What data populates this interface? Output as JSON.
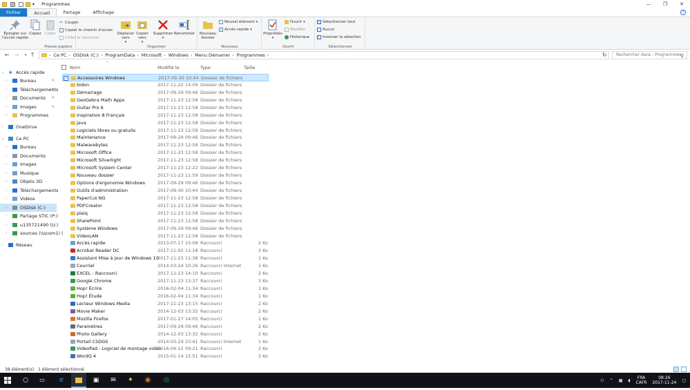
{
  "window": {
    "title": "Programmes",
    "controls": [
      "—",
      "❐",
      "✕"
    ]
  },
  "ribbon_tabs": [
    "Fichier",
    "Accueil",
    "Partage",
    "Affichage"
  ],
  "ribbon": {
    "presse_papiers": {
      "label": "Presse-papiers",
      "pin": "Épingler sur l'accès rapide",
      "copy": "Copier",
      "paste": "Coller",
      "cut": "Couper",
      "copy_path": "Copier le chemin d'accès",
      "paste_shortcut": "Coller le raccourci"
    },
    "organiser": {
      "label": "Organiser",
      "move": "Déplacer vers",
      "copy_to": "Copier vers",
      "delete": "Supprimer",
      "rename": "Renommer"
    },
    "nouveau": {
      "label": "Nouveau",
      "new_folder": "Nouveau dossier",
      "new_item": "Nouvel élément",
      "quick_access": "Accès rapide"
    },
    "ouvrir": {
      "label": "Ouvrir",
      "properties": "Propriétés",
      "open": "Ouvrir",
      "modify": "Modifier",
      "history": "Historique"
    },
    "selectionner": {
      "label": "Sélectionner",
      "select_all": "Sélectionner tout",
      "none": "Aucun",
      "invert": "Inverser la sélection"
    }
  },
  "address": {
    "path": [
      "Ce PC",
      "OSDisk (C:)",
      "ProgramData",
      "Microsoft",
      "Windows",
      "Menu Démarrer",
      "Programmes"
    ],
    "search_placeholder": "Rechercher dans : Programmes"
  },
  "nav_pane": [
    {
      "label": "Accès rapide",
      "level": 0,
      "icon": "star-icon",
      "expanded": true
    },
    {
      "label": "Bureau",
      "level": 1,
      "icon": "desktop-icon",
      "pinned": true
    },
    {
      "label": "Téléchargements",
      "level": 1,
      "icon": "download-icon",
      "pinned": true
    },
    {
      "label": "Documents",
      "level": 1,
      "icon": "documents-icon",
      "pinned": true
    },
    {
      "label": "Images",
      "level": 1,
      "icon": "images-icon",
      "pinned": true
    },
    {
      "label": "Programmes",
      "level": 1,
      "icon": "folder-icon"
    },
    {
      "label": "OneDrive",
      "level": 0,
      "icon": "cloud-icon"
    },
    {
      "label": "Ce PC",
      "level": 0,
      "icon": "computer-icon",
      "expanded": true
    },
    {
      "label": "Bureau",
      "level": 1,
      "icon": "desktop-icon"
    },
    {
      "label": "Documents",
      "level": 1,
      "icon": "documents-icon"
    },
    {
      "label": "Images",
      "level": 1,
      "icon": "images-icon"
    },
    {
      "label": "Musique",
      "level": 1,
      "icon": "music-icon"
    },
    {
      "label": "Objets 3D",
      "level": 1,
      "icon": "objects3d-icon"
    },
    {
      "label": "Téléchargements",
      "level": 1,
      "icon": "download-icon"
    },
    {
      "label": "Vidéos",
      "level": 1,
      "icon": "video-icon"
    },
    {
      "label": "OSDisk (C:)",
      "level": 1,
      "icon": "drive-icon",
      "selected": true
    },
    {
      "label": "Partage STIC (P:)",
      "level": 1,
      "icon": "network-drive-icon"
    },
    {
      "label": "u135721490 (U:)",
      "level": 1,
      "icon": "network-drive-icon"
    },
    {
      "label": "sources (\\\\scom1) (",
      "level": 1,
      "icon": "network-drive-icon"
    },
    {
      "label": "Réseau",
      "level": 0,
      "icon": "network-icon"
    }
  ],
  "columns": [
    "Nom",
    "Modifié le",
    "Type",
    "Taille"
  ],
  "files": [
    {
      "name": "Accessoires Windows",
      "date": "2017-09-30 10:44",
      "type": "Dossier de fichiers",
      "size": "",
      "kind": "folder",
      "selected": true
    },
    {
      "name": "bidon",
      "date": "2017-11-22 14:09",
      "type": "Dossier de fichiers",
      "size": "",
      "kind": "folder"
    },
    {
      "name": "Démarrage",
      "date": "2017-09-29 09:46",
      "type": "Dossier de fichiers",
      "size": "",
      "kind": "folder"
    },
    {
      "name": "GeoGebra Math Apps",
      "date": "2017-11-23 12:58",
      "type": "Dossier de fichiers",
      "size": "",
      "kind": "folder"
    },
    {
      "name": "Guitar Pro 6",
      "date": "2017-11-23 12:58",
      "type": "Dossier de fichiers",
      "size": "",
      "kind": "folder"
    },
    {
      "name": "Inspiration 8 Français",
      "date": "2017-11-23 12:58",
      "type": "Dossier de fichiers",
      "size": "",
      "kind": "folder"
    },
    {
      "name": "Java",
      "date": "2017-11-23 12:58",
      "type": "Dossier de fichiers",
      "size": "",
      "kind": "folder"
    },
    {
      "name": "Logiciels libres ou gratuits",
      "date": "2017-11-23 12:58",
      "type": "Dossier de fichiers",
      "size": "",
      "kind": "folder"
    },
    {
      "name": "Maintenance",
      "date": "2017-09-29 09:46",
      "type": "Dossier de fichiers",
      "size": "",
      "kind": "folder"
    },
    {
      "name": "Malwarebytes",
      "date": "2017-11-23 12:58",
      "type": "Dossier de fichiers",
      "size": "",
      "kind": "folder"
    },
    {
      "name": "Microsoft Office",
      "date": "2017-11-23 12:58",
      "type": "Dossier de fichiers",
      "size": "",
      "kind": "folder"
    },
    {
      "name": "Microsoft Silverlight",
      "date": "2017-11-23 12:58",
      "type": "Dossier de fichiers",
      "size": "",
      "kind": "folder"
    },
    {
      "name": "Microsoft System Center",
      "date": "2017-11-23 12:22",
      "type": "Dossier de fichiers",
      "size": "",
      "kind": "folder"
    },
    {
      "name": "Nouveau dossier",
      "date": "2017-11-23 11:59",
      "type": "Dossier de fichiers",
      "size": "",
      "kind": "folder"
    },
    {
      "name": "Options d'ergonomie Windows",
      "date": "2017-09-29 09:46",
      "type": "Dossier de fichiers",
      "size": "",
      "kind": "folder"
    },
    {
      "name": "Outils d'administration",
      "date": "2017-09-30 10:44",
      "type": "Dossier de fichiers",
      "size": "",
      "kind": "folder"
    },
    {
      "name": "PaperCut NG",
      "date": "2017-11-23 12:58",
      "type": "Dossier de fichiers",
      "size": "",
      "kind": "folder"
    },
    {
      "name": "PDFCreator",
      "date": "2017-11-23 12:58",
      "type": "Dossier de fichiers",
      "size": "",
      "kind": "folder"
    },
    {
      "name": "plaiq",
      "date": "2017-11-23 12:58",
      "type": "Dossier de fichiers",
      "size": "",
      "kind": "folder"
    },
    {
      "name": "SharePoint",
      "date": "2017-11-23 12:58",
      "type": "Dossier de fichiers",
      "size": "",
      "kind": "folder"
    },
    {
      "name": "Système Windows",
      "date": "2017-09-29 09:46",
      "type": "Dossier de fichiers",
      "size": "",
      "kind": "folder"
    },
    {
      "name": "VideoLAN",
      "date": "2017-11-23 12:58",
      "type": "Dossier de fichiers",
      "size": "",
      "kind": "folder"
    },
    {
      "name": "Accès rapide",
      "date": "2013-07-17 15:08",
      "type": "Raccourci",
      "size": "2 Ko",
      "kind": "shortcut",
      "color": "#6aa0d8"
    },
    {
      "name": "Acrobat Reader DC",
      "date": "2017-11-02 11:18",
      "type": "Raccourci",
      "size": "3 Ko",
      "kind": "shortcut",
      "color": "#c8282b"
    },
    {
      "name": "Assistant Mise à jour de Windows 10",
      "date": "2017-11-23 11:38",
      "type": "Raccourci",
      "size": "1 Ko",
      "kind": "shortcut",
      "color": "#2f7ad0"
    },
    {
      "name": "Courriel",
      "date": "2014-03-24 10:26",
      "type": "Raccourci Internet",
      "size": "1 Ko",
      "kind": "shortcut",
      "color": "#9aa4b0"
    },
    {
      "name": "EXCEL - Raccourci",
      "date": "2017-11-23 14:10",
      "type": "Raccourci",
      "size": "2 Ko",
      "kind": "shortcut",
      "color": "#1f7a44"
    },
    {
      "name": "Google Chrome",
      "date": "2017-11-23 13:37",
      "type": "Raccourci",
      "size": "3 Ko",
      "kind": "shortcut",
      "color": "#3c9a4a"
    },
    {
      "name": "Hop! Écrire",
      "date": "2016-02-04 11:34",
      "type": "Raccourci",
      "size": "1 Ko",
      "kind": "shortcut",
      "color": "#5fae3c"
    },
    {
      "name": "Hop! Étude",
      "date": "2016-02-04 11:34",
      "type": "Raccourci",
      "size": "1 Ko",
      "kind": "shortcut",
      "color": "#5fae3c"
    },
    {
      "name": "Lecteur Windows Media",
      "date": "2017-11-23 13:15",
      "type": "Raccourci",
      "size": "2 Ko",
      "kind": "shortcut",
      "color": "#2b69c4"
    },
    {
      "name": "Movie Maker",
      "date": "2014-12-03 13:32",
      "type": "Raccourci",
      "size": "2 Ko",
      "kind": "shortcut",
      "color": "#7a5aa8"
    },
    {
      "name": "Mozilla Firefox",
      "date": "2017-01-27 14:05",
      "type": "Raccourci",
      "size": "1 Ko",
      "kind": "shortcut",
      "color": "#e0751f"
    },
    {
      "name": "Paramètres",
      "date": "2017-09-29 09:46",
      "type": "Raccourci",
      "size": "2 Ko",
      "kind": "shortcut",
      "color": "#5e6b78"
    },
    {
      "name": "Photo Gallery",
      "date": "2014-12-03 13:32",
      "type": "Raccourci",
      "size": "2 Ko",
      "kind": "shortcut",
      "color": "#d26a32"
    },
    {
      "name": "Portail CSDGS",
      "date": "2014-03-24 10:41",
      "type": "Raccourci Internet",
      "size": "1 Ko",
      "kind": "shortcut",
      "color": "#9aa4b0"
    },
    {
      "name": "VideoPad - Logiciel de montage vidéo",
      "date": "2016-04-12 09:21",
      "type": "Raccourci",
      "size": "2 Ko",
      "kind": "shortcut",
      "color": "#3a9a5c"
    },
    {
      "name": "WordQ 4",
      "date": "2015-01-14 15:51",
      "type": "Raccourci",
      "size": "2 Ko",
      "kind": "shortcut",
      "color": "#4a6fb0"
    }
  ],
  "status": {
    "count": "38 élément(s)",
    "selected": "1 élément sélectionné"
  },
  "taskbar": {
    "lang1": "FRA",
    "lang2": "CAFR",
    "time": "08:26",
    "date": "2017-11-24"
  }
}
